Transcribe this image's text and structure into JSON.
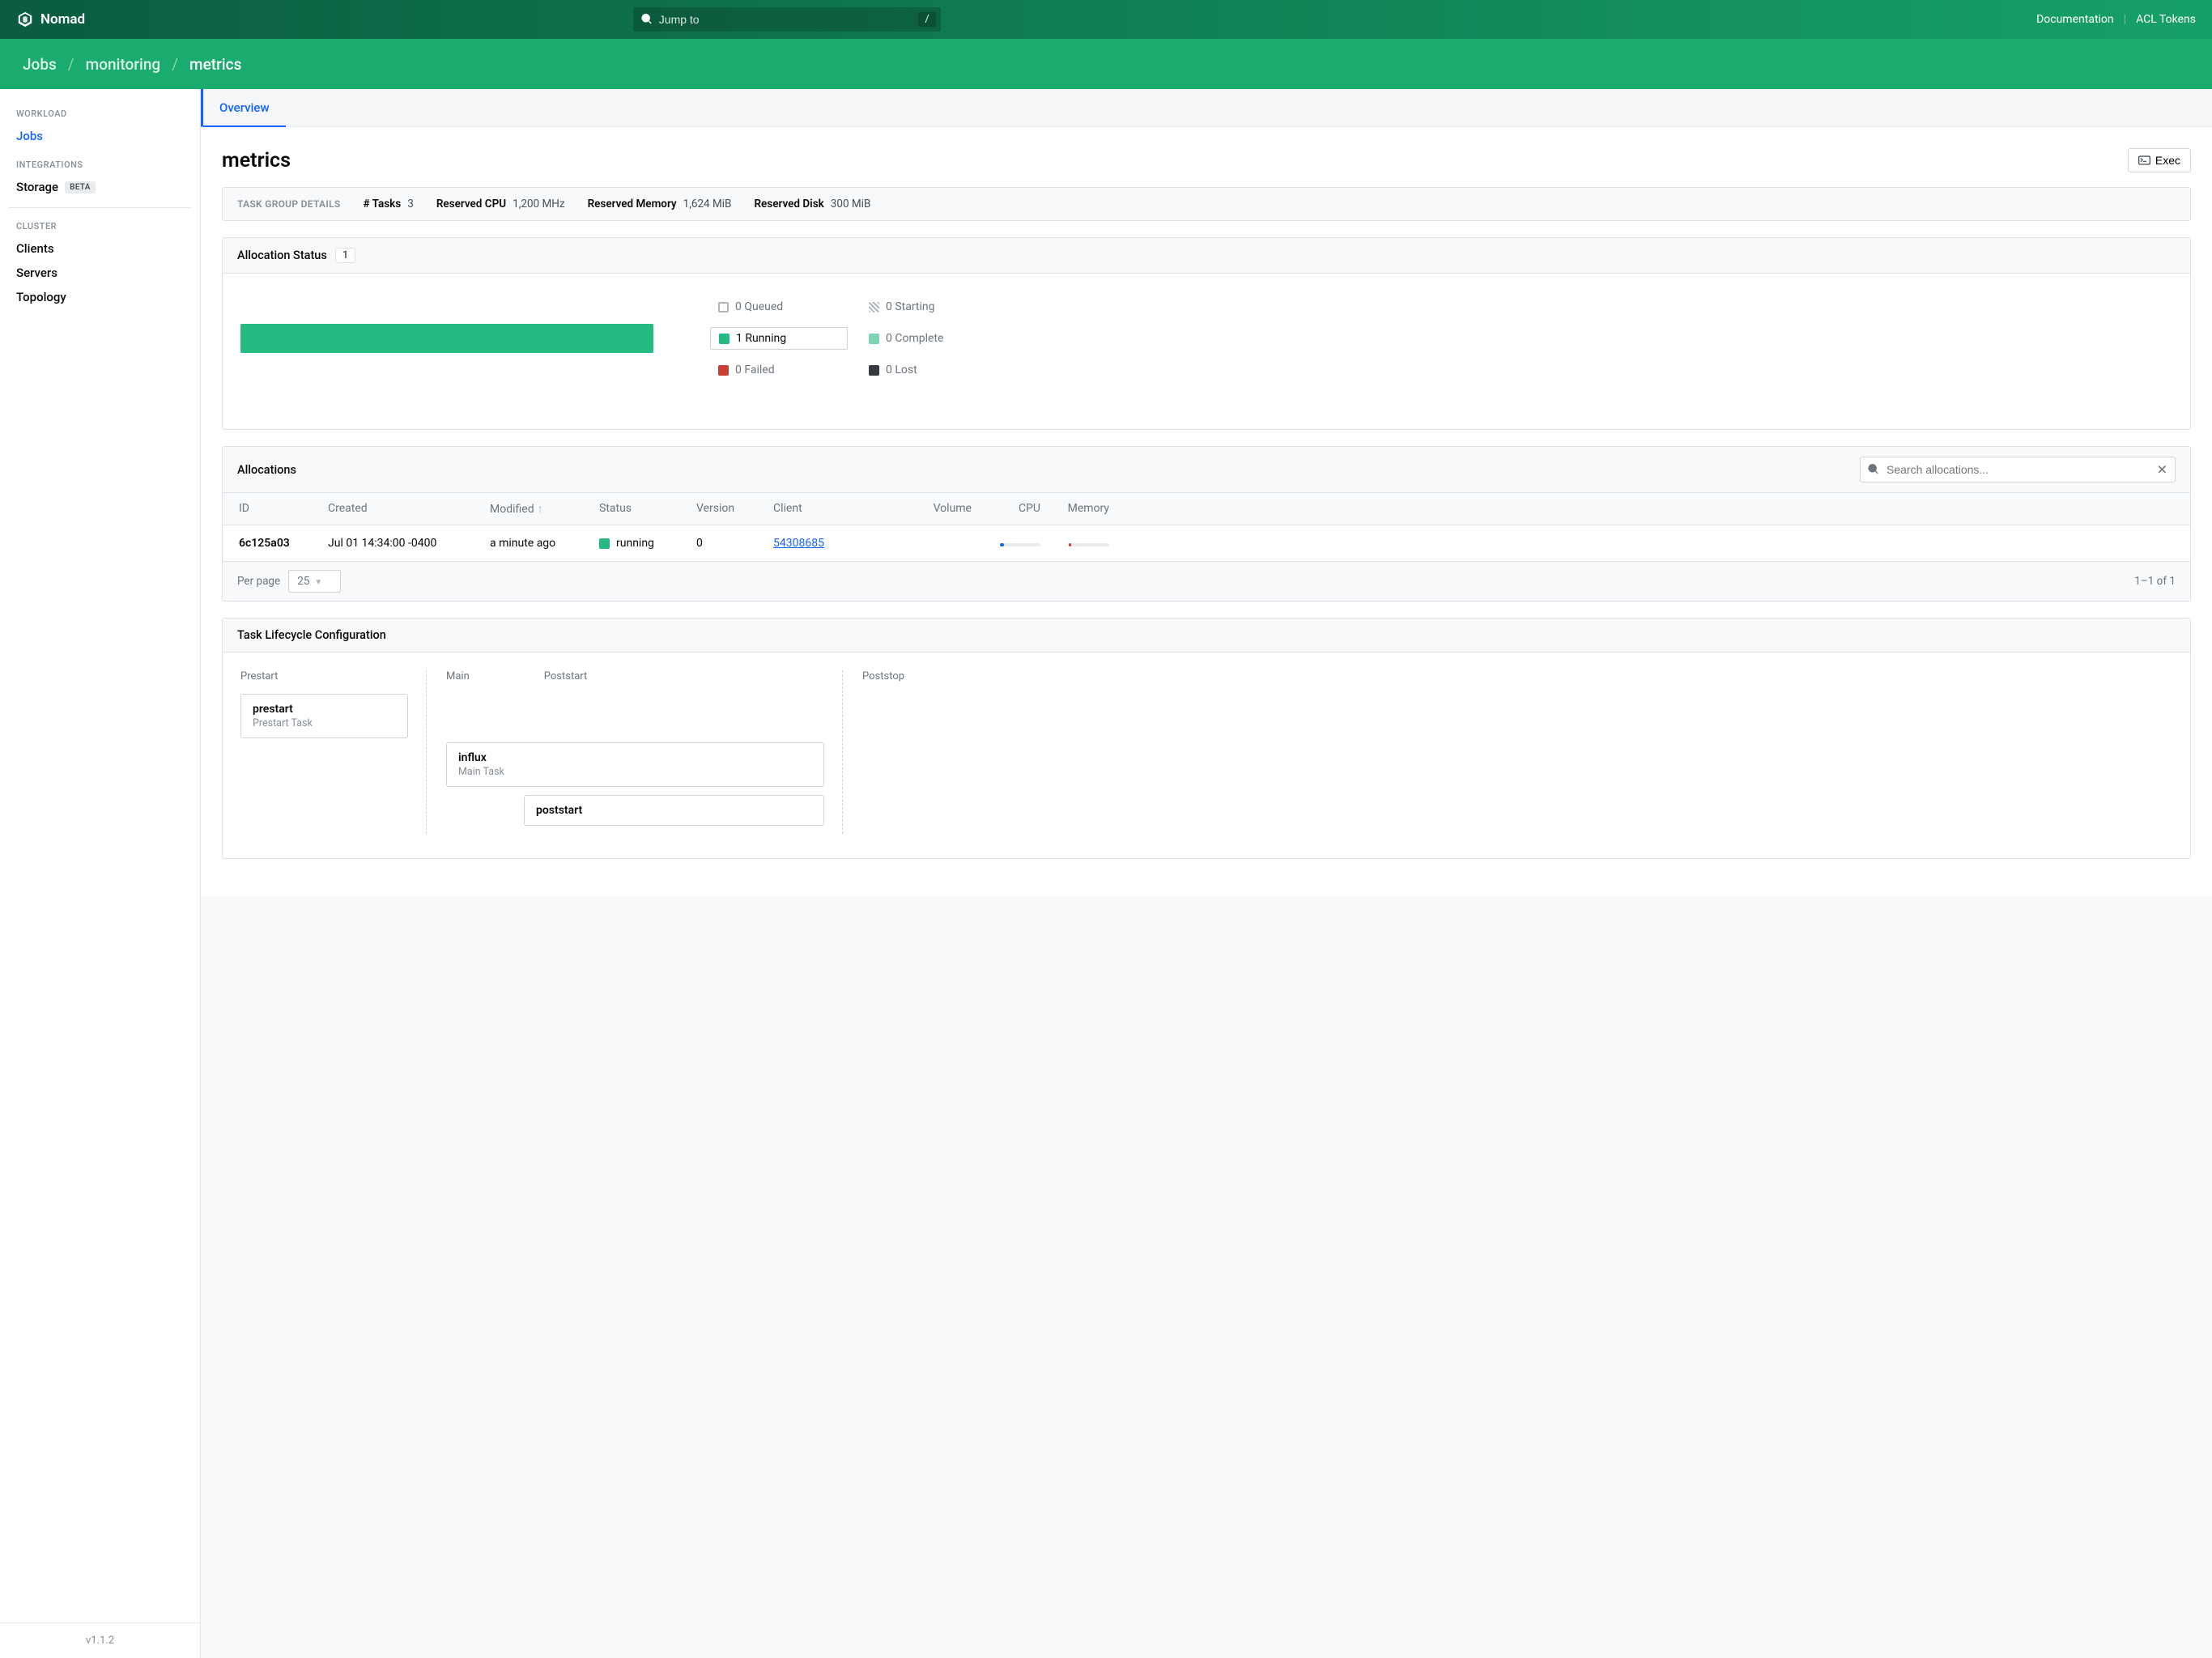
{
  "brand": "Nomad",
  "search": {
    "placeholder": "Jump to",
    "kbd": "/"
  },
  "topbar": {
    "doc": "Documentation",
    "tokens": "ACL Tokens"
  },
  "breadcrumb": {
    "jobs": "Jobs",
    "parent": "monitoring",
    "current": "metrics"
  },
  "sidebar": {
    "workload_h": "WORKLOAD",
    "jobs": "Jobs",
    "integrations_h": "INTEGRATIONS",
    "storage": "Storage",
    "storage_badge": "BETA",
    "cluster_h": "CLUSTER",
    "clients": "Clients",
    "servers": "Servers",
    "topology": "Topology"
  },
  "version": "v1.1.2",
  "tab_overview": "Overview",
  "page_title": "metrics",
  "exec_label": "Exec",
  "strip": {
    "label": "TASK GROUP DETAILS",
    "tasks_k": "# Tasks",
    "tasks_v": "3",
    "cpu_k": "Reserved CPU",
    "cpu_v": "1,200 MHz",
    "mem_k": "Reserved Memory",
    "mem_v": "1,624 MiB",
    "disk_k": "Reserved Disk",
    "disk_v": "300 MiB"
  },
  "alloc_status": {
    "title": "Allocation Status",
    "count": "1",
    "legend": {
      "queued": "0 Queued",
      "starting": "0 Starting",
      "running": "1 Running",
      "complete": "0 Complete",
      "failed": "0 Failed",
      "lost": "0 Lost"
    }
  },
  "allocations": {
    "title": "Allocations",
    "search_ph": "Search allocations...",
    "headers": {
      "id": "ID",
      "created": "Created",
      "modified": "Modified",
      "status": "Status",
      "version": "Version",
      "client": "Client",
      "volume": "Volume",
      "cpu": "CPU",
      "memory": "Memory"
    },
    "row": {
      "id": "6c125a03",
      "created": "Jul 01 14:34:00 -0400",
      "modified": "a minute ago",
      "status": "running",
      "version": "0",
      "client": "54308685"
    },
    "per_page_label": "Per page",
    "per_page_value": "25",
    "page_info": "1–1 of 1"
  },
  "lifecycle": {
    "title": "Task Lifecycle Configuration",
    "heads": {
      "prestart": "Prestart",
      "main": "Main",
      "poststart": "Poststart",
      "poststop": "Poststop"
    },
    "prestart": {
      "name": "prestart",
      "sub": "Prestart Task"
    },
    "main": {
      "name": "influx",
      "sub": "Main Task"
    },
    "poststart": {
      "name": "poststart"
    }
  }
}
